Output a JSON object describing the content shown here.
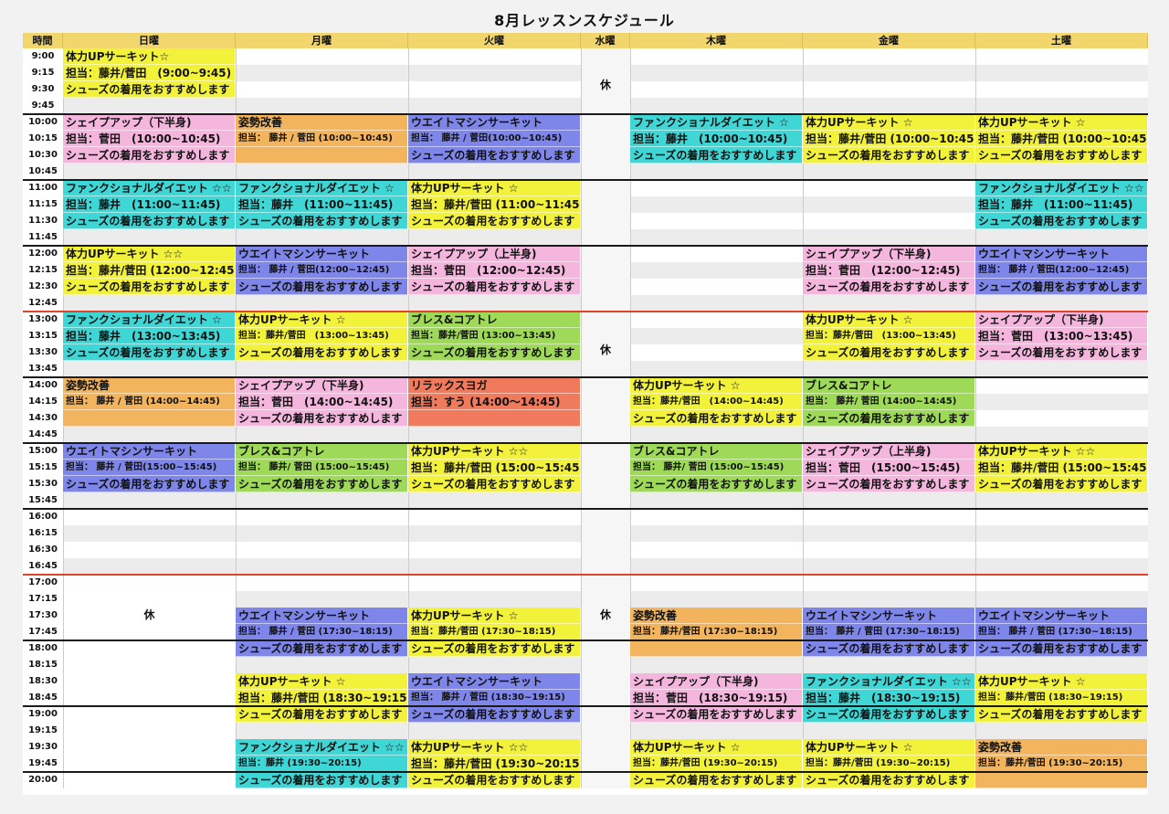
{
  "title": "8月レッスンスケジュール",
  "headers": [
    "時間",
    "日曜",
    "月曜",
    "火曜",
    "水曜",
    "木曜",
    "金曜",
    "土曜"
  ],
  "times": [
    "9:00",
    "9:15",
    "9:30",
    "9:45",
    "10:00",
    "10:15",
    "10:30",
    "10:45",
    "11:00",
    "11:15",
    "11:30",
    "11:45",
    "12:00",
    "12:15",
    "12:30",
    "12:45",
    "13:00",
    "13:15",
    "13:30",
    "13:45",
    "14:00",
    "14:15",
    "14:30",
    "14:45",
    "15:00",
    "15:15",
    "15:30",
    "15:45",
    "16:00",
    "16:15",
    "16:30",
    "16:45",
    "17:00",
    "17:15",
    "17:30",
    "17:45",
    "18:00",
    "18:15",
    "18:30",
    "18:45",
    "19:00",
    "19:15",
    "19:30",
    "19:45",
    "20:00"
  ],
  "rest": "休",
  "colors": {
    "yellow": "#f2f23a",
    "pink": "#f4b6dd",
    "orange": "#f2b45c",
    "blue": "#7f86ea",
    "cyan": "#3fd6d6",
    "green": "#9ed957",
    "red": "#f07a5c",
    "header": "#f1d66e"
  },
  "blocks": [
    {
      "c": 0,
      "r": 0,
      "n": 3,
      "col": "yellow",
      "lines": [
        "体力UPサーキット☆",
        "担当：藤井/菅田　(9:00~9:45)",
        "シューズの着用をおすすめします"
      ]
    },
    {
      "c": 0,
      "r": 4,
      "n": 3,
      "col": "pink",
      "lines": [
        "シェイプアップ（下半身)",
        "担当：菅田　(10:00~10:45)",
        "シューズの着用をおすすめします"
      ]
    },
    {
      "c": 1,
      "r": 4,
      "n": 3,
      "col": "orange",
      "lines": [
        "姿勢改善",
        "担当： 藤井 / 菅田 (10:00~10:45)",
        ""
      ],
      "small": [
        1
      ]
    },
    {
      "c": 2,
      "r": 4,
      "n": 3,
      "col": "blue",
      "lines": [
        "ウエイトマシンサーキット",
        "担当： 藤井 / 菅田(10:00~10:45)",
        "シューズの着用をおすすめします"
      ],
      "small": [
        1
      ]
    },
    {
      "c": 4,
      "r": 4,
      "n": 3,
      "col": "cyan",
      "lines": [
        "ファンクショナルダイエット ☆",
        "担当：藤井　(10:00~10:45)",
        "シューズの着用をおすすめします"
      ]
    },
    {
      "c": 5,
      "r": 4,
      "n": 3,
      "col": "yellow",
      "lines": [
        "体力UPサーキット ☆",
        "担当：藤井/菅田 (10:00~10:45)",
        "シューズの着用をおすすめします"
      ]
    },
    {
      "c": 6,
      "r": 4,
      "n": 3,
      "col": "yellow",
      "lines": [
        "体力UPサーキット ☆",
        "担当：藤井/菅田 (10:00~10:45)",
        "シューズの着用をおすすめします"
      ]
    },
    {
      "c": 0,
      "r": 8,
      "n": 3,
      "col": "cyan",
      "lines": [
        "ファンクショナルダイエット ☆☆",
        "担当：藤井　(11:00~11:45)",
        "シューズの着用をおすすめします"
      ]
    },
    {
      "c": 1,
      "r": 8,
      "n": 3,
      "col": "cyan",
      "lines": [
        "ファンクショナルダイエット ☆",
        "担当：藤井　(11:00~11:45)",
        "シューズの着用をおすすめします"
      ]
    },
    {
      "c": 2,
      "r": 8,
      "n": 3,
      "col": "yellow",
      "lines": [
        "体力UPサーキット ☆",
        "担当：藤井/菅田 (11:00~11:45)",
        "シューズの着用をおすすめします"
      ]
    },
    {
      "c": 6,
      "r": 8,
      "n": 3,
      "col": "cyan",
      "lines": [
        "ファンクショナルダイエット ☆☆",
        "担当：藤井　(11:00~11:45)",
        "シューズの着用をおすすめします"
      ]
    },
    {
      "c": 0,
      "r": 12,
      "n": 3,
      "col": "yellow",
      "lines": [
        "体力UPサーキット ☆☆",
        "担当：藤井/菅田 (12:00~12:45)",
        "シューズの着用をおすすめします"
      ]
    },
    {
      "c": 1,
      "r": 12,
      "n": 3,
      "col": "blue",
      "lines": [
        "ウエイトマシンサーキット",
        "担当： 藤井 / 菅田(12:00~12:45)",
        "シューズの着用をおすすめします"
      ],
      "small": [
        1
      ]
    },
    {
      "c": 2,
      "r": 12,
      "n": 3,
      "col": "pink",
      "lines": [
        "シェイプアップ（上半身)",
        "担当：菅田　(12:00~12:45)",
        "シューズの着用をおすすめします"
      ]
    },
    {
      "c": 5,
      "r": 12,
      "n": 3,
      "col": "pink",
      "lines": [
        "シェイプアップ（下半身)",
        "担当：菅田　(12:00~12:45)",
        "シューズの着用をおすすめします"
      ]
    },
    {
      "c": 6,
      "r": 12,
      "n": 3,
      "col": "blue",
      "lines": [
        "ウエイトマシンサーキット",
        "担当： 藤井 / 菅田(12:00~12:45)",
        "シューズの着用をおすすめします"
      ],
      "small": [
        1
      ]
    },
    {
      "c": 0,
      "r": 16,
      "n": 3,
      "col": "cyan",
      "lines": [
        "ファンクショナルダイエット ☆",
        "担当：藤井　(13:00~13:45)",
        "シューズの着用をおすすめします"
      ]
    },
    {
      "c": 1,
      "r": 16,
      "n": 3,
      "col": "yellow",
      "lines": [
        "体力UPサーキット ☆",
        "担当：藤井/菅田　(13:00~13:45)",
        "シューズの着用をおすすめします"
      ],
      "small": [
        1
      ]
    },
    {
      "c": 2,
      "r": 16,
      "n": 3,
      "col": "green",
      "lines": [
        "ブレス&コアトレ",
        "担当：藤井/菅田 (13:00~13:45)",
        "シューズの着用をおすすめします"
      ],
      "small": [
        1
      ]
    },
    {
      "c": 5,
      "r": 16,
      "n": 3,
      "col": "yellow",
      "lines": [
        "体力UPサーキット ☆",
        "担当：藤井/菅田　(13:00~13:45)",
        "シューズの着用をおすすめします"
      ],
      "small": [
        1
      ]
    },
    {
      "c": 6,
      "r": 16,
      "n": 3,
      "col": "pink",
      "lines": [
        "シェイプアップ（下半身)",
        "担当：菅田　(13:00~13:45)",
        "シューズの着用をおすすめします"
      ]
    },
    {
      "c": 0,
      "r": 20,
      "n": 3,
      "col": "orange",
      "lines": [
        "姿勢改善",
        "担当： 藤井 / 菅田 (14:00~14:45)",
        ""
      ],
      "small": [
        1
      ]
    },
    {
      "c": 1,
      "r": 20,
      "n": 3,
      "col": "pink",
      "lines": [
        "シェイプアップ（下半身)",
        "担当：菅田　(14:00~14:45)",
        "シューズの着用をおすすめします"
      ]
    },
    {
      "c": 2,
      "r": 20,
      "n": 3,
      "col": "red",
      "lines": [
        "リラックスヨガ",
        "担当：すう (14:00～14:45)",
        ""
      ]
    },
    {
      "c": 4,
      "r": 20,
      "n": 3,
      "col": "yellow",
      "lines": [
        "体力UPサーキット ☆",
        "担当：藤井/菅田　(14:00~14:45)",
        "シューズの着用をおすすめします"
      ],
      "small": [
        1
      ]
    },
    {
      "c": 5,
      "r": 20,
      "n": 3,
      "col": "green",
      "lines": [
        "ブレス&コアトレ",
        "担当： 藤井/ 菅田 (14:00~14:45)",
        "シューズの着用をおすすめします"
      ],
      "small": [
        1
      ]
    },
    {
      "c": 0,
      "r": 24,
      "n": 3,
      "col": "blue",
      "lines": [
        "ウエイトマシンサーキット",
        "担当： 藤井 / 菅田(15:00~15:45)",
        "シューズの着用をおすすめします"
      ],
      "small": [
        1
      ]
    },
    {
      "c": 1,
      "r": 24,
      "n": 3,
      "col": "green",
      "lines": [
        "ブレス&コアトレ",
        "担当： 藤井/ 菅田 (15:00~15:45)",
        "シューズの着用をおすすめします"
      ],
      "small": [
        1
      ]
    },
    {
      "c": 2,
      "r": 24,
      "n": 3,
      "col": "yellow",
      "lines": [
        "体力UPサーキット ☆☆",
        "担当：藤井/菅田 (15:00~15:45)",
        "シューズの着用をおすすめします"
      ]
    },
    {
      "c": 4,
      "r": 24,
      "n": 3,
      "col": "green",
      "lines": [
        "ブレス&コアトレ",
        "担当： 藤井/ 菅田 (15:00~15:45)",
        "シューズの着用をおすすめします"
      ],
      "small": [
        1
      ]
    },
    {
      "c": 5,
      "r": 24,
      "n": 3,
      "col": "pink",
      "lines": [
        "シェイプアップ（上半身)",
        "担当：菅田　(15:00~15:45)",
        "シューズの着用をおすすめします"
      ]
    },
    {
      "c": 6,
      "r": 24,
      "n": 3,
      "col": "yellow",
      "lines": [
        "体力UPサーキット ☆☆",
        "担当：藤井/菅田 (15:00~15:45)",
        "シューズの着用をおすすめします"
      ]
    },
    {
      "c": 1,
      "r": 34,
      "n": 3,
      "col": "blue",
      "lines": [
        "ウエイトマシンサーキット",
        "担当： 藤井 / 菅田 (17:30~18:15)",
        "シューズの着用をおすすめします"
      ],
      "small": [
        1
      ]
    },
    {
      "c": 2,
      "r": 34,
      "n": 3,
      "col": "yellow",
      "lines": [
        "体力UPサーキット ☆",
        "担当：藤井/菅田 (17:30~18:15)",
        "シューズの着用をおすすめします"
      ],
      "small": [
        1
      ]
    },
    {
      "c": 4,
      "r": 34,
      "n": 3,
      "col": "orange",
      "lines": [
        "姿勢改善",
        "担当：藤井/菅田 (17:30~18:15)",
        ""
      ],
      "small": [
        1
      ]
    },
    {
      "c": 5,
      "r": 34,
      "n": 3,
      "col": "blue",
      "lines": [
        "ウエイトマシンサーキット",
        "担当： 藤井 / 菅田 (17:30~18:15)",
        "シューズの着用をおすすめします"
      ],
      "small": [
        1
      ]
    },
    {
      "c": 6,
      "r": 34,
      "n": 3,
      "col": "blue",
      "lines": [
        "ウエイトマシンサーキット",
        "担当： 藤井 / 菅田 (17:30~18:15)",
        "シューズの着用をおすすめします"
      ],
      "small": [
        1
      ]
    },
    {
      "c": 1,
      "r": 38,
      "n": 3,
      "col": "yellow",
      "lines": [
        "体力UPサーキット ☆",
        "担当：藤井/菅田 (18:30~19:15)",
        "シューズの着用をおすすめします"
      ]
    },
    {
      "c": 2,
      "r": 38,
      "n": 3,
      "col": "blue",
      "lines": [
        "ウエイトマシンサーキット",
        "担当： 藤井 / 菅田 (18:30~19:15)",
        "シューズの着用をおすすめします"
      ],
      "small": [
        1
      ]
    },
    {
      "c": 4,
      "r": 38,
      "n": 3,
      "col": "pink",
      "lines": [
        "シェイプアップ（下半身)",
        "担当：菅田　(18:30~19:15)",
        "シューズの着用をおすすめします"
      ]
    },
    {
      "c": 5,
      "r": 38,
      "n": 3,
      "col": "cyan",
      "lines": [
        "ファンクショナルダイエット ☆☆",
        "担当：藤井　(18:30~19:15)",
        "シューズの着用をおすすめします"
      ]
    },
    {
      "c": 6,
      "r": 38,
      "n": 3,
      "col": "yellow",
      "lines": [
        "体力UPサーキット ☆",
        "担当：藤井/菅田 (18:30~19:15)",
        "シューズの着用をおすすめします"
      ],
      "small": [
        1
      ]
    },
    {
      "c": 1,
      "r": 42,
      "n": 3,
      "col": "cyan",
      "lines": [
        "ファンクショナルダイエット ☆☆",
        "担当：藤井 (19:30~20:15)",
        "シューズの着用をおすすめします"
      ],
      "small": [
        1
      ]
    },
    {
      "c": 2,
      "r": 42,
      "n": 3,
      "col": "yellow",
      "lines": [
        "体力UPサーキット ☆☆",
        "担当：藤井/菅田 (19:30~20:15)",
        "シューズの着用をおすすめします"
      ]
    },
    {
      "c": 4,
      "r": 42,
      "n": 3,
      "col": "yellow",
      "lines": [
        "体力UPサーキット ☆",
        "担当：藤井/菅田 (19:30~20:15)",
        "シューズの着用をおすすめします"
      ],
      "small": [
        1
      ]
    },
    {
      "c": 5,
      "r": 42,
      "n": 3,
      "col": "yellow",
      "lines": [
        "体力UPサーキット ☆",
        "担当：藤井/菅田 (19:30~20:15)",
        "シューズの着用をおすすめします"
      ],
      "small": [
        1
      ]
    },
    {
      "c": 6,
      "r": 42,
      "n": 3,
      "col": "orange",
      "lines": [
        "姿勢改善",
        "担当：藤井/菅田 (19:30~20:15)",
        ""
      ],
      "small": [
        1
      ]
    }
  ]
}
